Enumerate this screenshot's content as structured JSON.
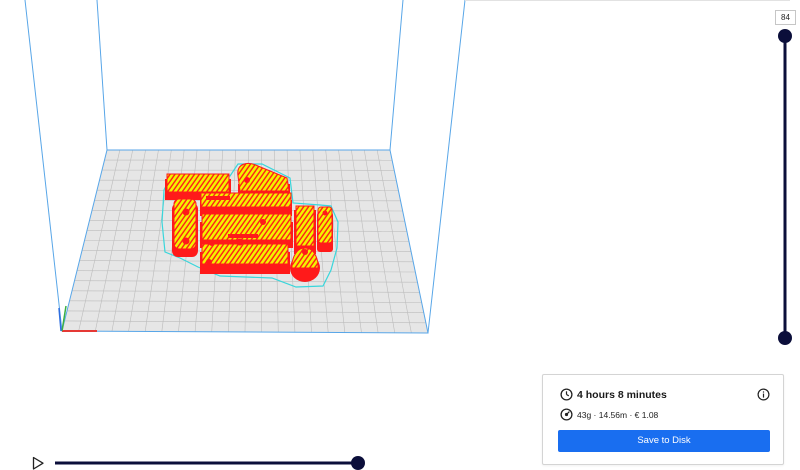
{
  "layer_slider": {
    "upper_label": "84",
    "upper_fraction": 1,
    "lower_fraction": 0
  },
  "simulation": {
    "progress": 1
  },
  "print_info": {
    "time": "4 hours 8 minutes",
    "material": "43g · 14.56m · € 1.08",
    "save_button_label": "Save to Disk"
  },
  "icons": {
    "play": "play-icon",
    "time": "clock-icon",
    "info": "info-icon",
    "material": "filament-gauge-icon"
  },
  "colors": {
    "accent": "#196ef0",
    "slider": "#0b0e3a",
    "wall": "#ff1a1a",
    "infill": "#f2f200",
    "skirt": "#39d6db",
    "build_volume": "#58a6e8",
    "plate": "#e6e6e6"
  }
}
